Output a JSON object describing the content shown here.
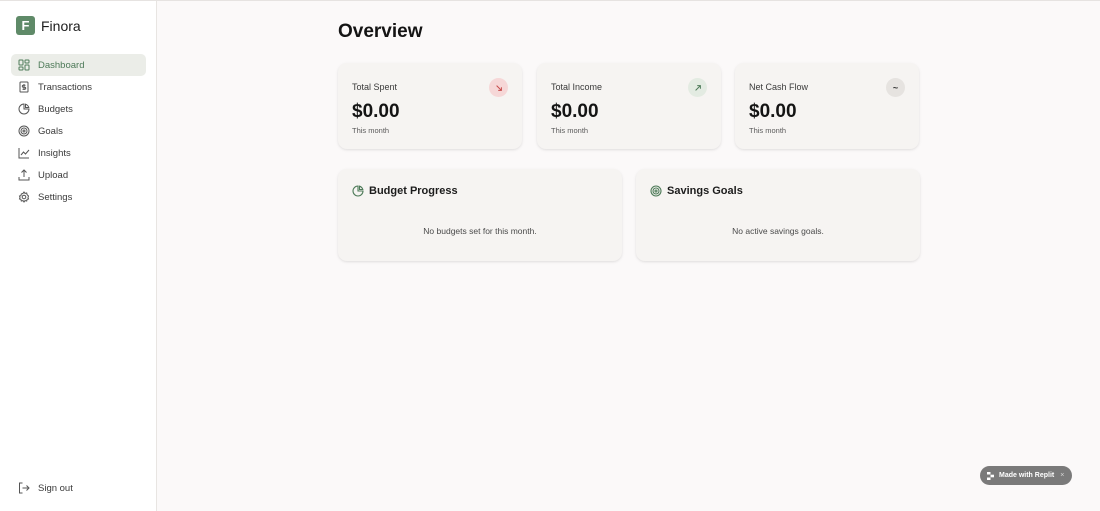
{
  "app": {
    "logo_letter": "F",
    "name": "Finora"
  },
  "sidebar": {
    "items": [
      {
        "label": "Dashboard",
        "icon": "dashboard-icon",
        "active": true
      },
      {
        "label": "Transactions",
        "icon": "receipt-icon"
      },
      {
        "label": "Budgets",
        "icon": "pie-chart-icon"
      },
      {
        "label": "Goals",
        "icon": "target-icon"
      },
      {
        "label": "Insights",
        "icon": "trend-line-icon"
      },
      {
        "label": "Upload",
        "icon": "upload-icon"
      },
      {
        "label": "Settings",
        "icon": "gear-icon"
      }
    ],
    "signout": {
      "label": "Sign out",
      "icon": "sign-out-icon"
    }
  },
  "main": {
    "title": "Overview",
    "stats": [
      {
        "label": "Total Spent",
        "value": "$0.00",
        "sub": "This month",
        "badge_icon": "arrow-down-right-icon",
        "badge_color": "#c64a4a"
      },
      {
        "label": "Total Income",
        "value": "$0.00",
        "sub": "This month",
        "badge_icon": "arrow-up-right-icon",
        "badge_color": "#4d7a58"
      },
      {
        "label": "Net Cash Flow",
        "value": "$0.00",
        "sub": "This month",
        "badge_icon": "approx-icon",
        "badge_symbol": "~",
        "badge_color": "#333333"
      }
    ],
    "panels": [
      {
        "title": "Budget Progress",
        "empty_text": "No budgets set for this month.",
        "icon": "pie-chart-icon"
      },
      {
        "title": "Savings Goals",
        "empty_text": "No active savings goals.",
        "icon": "target-icon"
      }
    ]
  },
  "badge": {
    "label": "Made with Replit",
    "close": "×"
  },
  "colors": {
    "accent": "#5f8a68",
    "active_bg": "#ebede8",
    "card_bg": "#f6f4f2",
    "page_bg": "#fbf9f9"
  }
}
